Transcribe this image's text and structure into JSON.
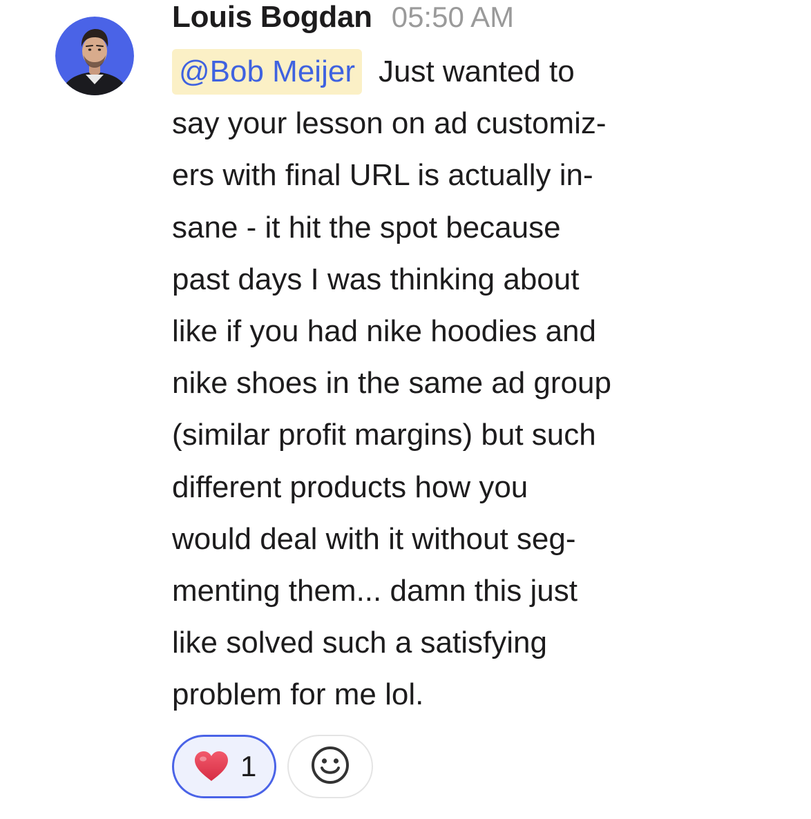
{
  "message": {
    "sender": "Louis Bogdan",
    "timestamp": "05:50 AM",
    "mention": "@Bob Meijer",
    "lines": [
      "Just wanted to",
      "say your lesson on ad customiz-",
      "ers with final URL is actually in-",
      "sane - it hit the spot because",
      "past days I was thinking about",
      "like if you had nike hoodies and",
      "nike shoes in the same ad group",
      "(similar profit margins) but such",
      "different products how you",
      "would deal with it without seg-",
      "menting them... damn this just",
      "like solved such a satisfying",
      "problem for me lol."
    ]
  },
  "reactions": [
    {
      "emoji": "heart-icon",
      "count": "1",
      "selected": true
    }
  ],
  "add_reaction": {
    "icon": "smiley-face-icon"
  },
  "colors": {
    "avatar_bg": "#4a63e7",
    "mention_bg": "#fbf0c6",
    "mention_text": "#3f62e0",
    "reaction_border": "#4a63e7",
    "reaction_bg": "#eef1fd",
    "heart": "#e0344a",
    "timestamp": "#9a9a9a"
  }
}
